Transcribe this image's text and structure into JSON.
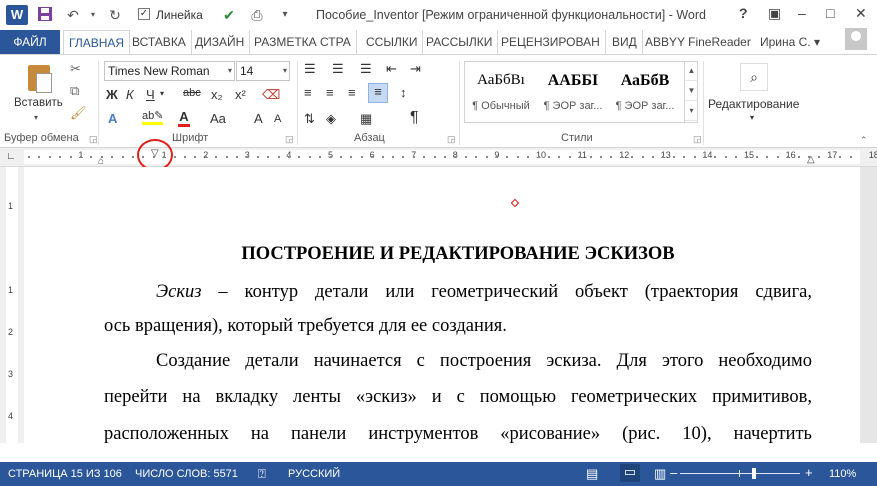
{
  "title_bar": {
    "app_icon": "W",
    "linejka_label": "Линейка",
    "linejka_checked": "✓",
    "document_title": "Пособие_Inventor [Режим ограниченной функциональности] - Word",
    "help": "?",
    "icons": [
      "save-icon",
      "undo-icon",
      "redo-icon",
      "checkbox-icon",
      "print-preview-icon",
      "customize-icon"
    ]
  },
  "tabs": [
    "ФАЙЛ",
    "ГЛАВНАЯ",
    "ВСТАВКА",
    "ДИЗАЙН",
    "РАЗМЕТКА СТРА",
    "ССЫЛКИ",
    "РАССЫЛКИ",
    "РЕЦЕНЗИРОВАН",
    "ВИД",
    "ABBYY FineReader"
  ],
  "user": {
    "name": "Ирина С."
  },
  "ribbon": {
    "clipboard": {
      "paste_label": "Вставить",
      "group_label": "Буфер обмена"
    },
    "font": {
      "font_name": "Times New Roman",
      "font_size": "14",
      "group_label": "Шрифт",
      "bold": "Ж",
      "italic": "К",
      "underline": "Ч",
      "strike": "abc",
      "subscript": "x₂",
      "superscript": "x²",
      "case": "Aa",
      "grow": "A",
      "shrink": "A"
    },
    "paragraph": {
      "group_label": "Абзац"
    },
    "styles": {
      "group_label": "Стили",
      "items": [
        {
          "sample": "АаБбВı",
          "name": "¶ Обычный"
        },
        {
          "sample": "ААББІ",
          "name": "¶ ЭОР заг..."
        },
        {
          "sample": "АаБбВ",
          "name": "¶ ЭОР заг..."
        }
      ]
    },
    "editing": {
      "label": "Редактирование"
    }
  },
  "ruler": {
    "numbers": [
      "1",
      "1",
      "2",
      "3",
      "4",
      "5",
      "6",
      "7",
      "8",
      "9",
      "10",
      "11",
      "12",
      "13",
      "14",
      "15",
      "16",
      "17",
      "18"
    ]
  },
  "vertical_ruler": {
    "numbers": [
      "1",
      "1",
      "2",
      "3",
      "4"
    ]
  },
  "document": {
    "title": "ПОСТРОЕНИЕ И РЕДАКТИРОВАНИЕ ЭСКИЗОВ",
    "p1_italic": "Эскиз",
    "p1_line1_rest": " – контур детали или геометрический объект (траектория сдвига,",
    "p1_line2": "ось вращения), который требуется для ее создания.",
    "p2_line1": "Создание детали начинается с построения эскиза. Для этого необходимо",
    "p2_line2": "перейти на вкладку ленты «эскиз» и с помощью геометрических примитивов,",
    "p2_line3": "расположенных на панели инструментов «рисование» (рис. 10), начертить"
  },
  "status_bar": {
    "page": "СТРАНИЦА 15 ИЗ 106",
    "words": "ЧИСЛО СЛОВ: 5571",
    "language": "РУССКИЙ",
    "zoom": "110%"
  },
  "colors": {
    "accent": "#2b579a",
    "highlight_circle": "#e0201a"
  }
}
